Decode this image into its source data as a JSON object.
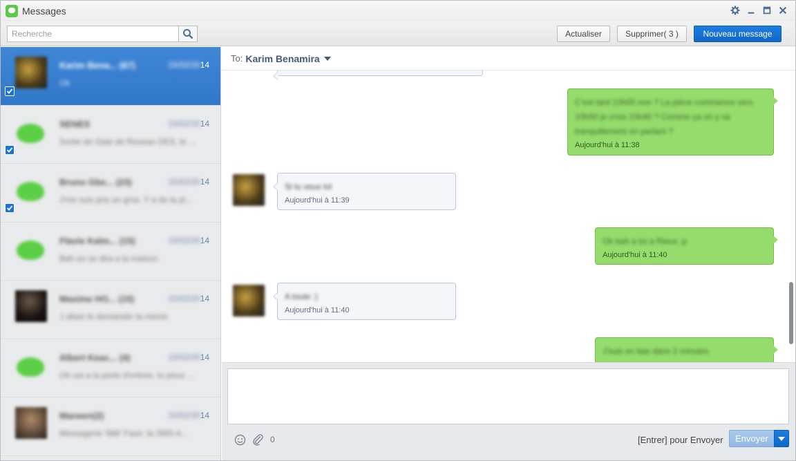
{
  "window": {
    "title": "Messages"
  },
  "toolbar": {
    "search_placeholder": "Recherche",
    "refresh_label": "Actualiser",
    "delete_label": "Supprimer( 3 )",
    "new_message_label": "Nouveau message"
  },
  "conversations": [
    {
      "name": "Karim Bena... (67)",
      "date_blur": "15/02/20",
      "date_tail": "14",
      "snippet": "Ok",
      "avatar": "photo1",
      "checked": true,
      "active": true
    },
    {
      "name": "SENES",
      "date_blur": "15/02/20",
      "date_tail": "14",
      "snippet": "Sortie de Gate de Reveau GES, le ...",
      "avatar": "green",
      "checked": true,
      "active": false
    },
    {
      "name": "Bruno Gbe... (23)",
      "date_blur": "15/02/20",
      "date_tail": "14",
      "snippet": "J'me suis pris un gros. Y a de la pl...",
      "avatar": "green",
      "checked": true,
      "active": false
    },
    {
      "name": "Flavie Kalm... (15)",
      "date_blur": "15/02/20",
      "date_tail": "14",
      "snippet": "Bah on se dira a la maison.",
      "avatar": "green",
      "checked": false,
      "active": false
    },
    {
      "name": "Maxime HO... (15)",
      "date_blur": "15/02/20",
      "date_tail": "14",
      "snippet": "J allais te demander la meme",
      "avatar": "photo2",
      "checked": false,
      "active": false
    },
    {
      "name": "Albert Keac... (4)",
      "date_blur": "15/02/20",
      "date_tail": "14",
      "snippet": "Oh oui a la porte d'entree, tu peux ...",
      "avatar": "green",
      "checked": false,
      "active": false
    },
    {
      "name": "Marwen(2)",
      "date_blur": "15/02/20",
      "date_tail": "14",
      "snippet": "Messagerie '666' Faxe: la SMS d...",
      "avatar": "photo3",
      "checked": false,
      "active": false
    }
  ],
  "chat": {
    "to_label": "To:",
    "recipient": "Karim Benamira",
    "messages": [
      {
        "dir": "out",
        "text": "C'est tard 10h00 non ? La pièce commence vers 10h00 je crois 10h40 ? Comme ça on y va tranquillement en parlant ?",
        "time": "Aujourd'hui à 11:38"
      },
      {
        "dir": "in",
        "text": "Si tu veux lol",
        "time": "Aujourd'hui à 11:39"
      },
      {
        "dir": "out",
        "text": "Ok bah a toi a Rieux :p",
        "time": "Aujourd'hui à 11:40"
      },
      {
        "dir": "in",
        "text": "A toute :)",
        "time": "Aujourd'hui à 11:40"
      },
      {
        "dir": "out",
        "text": "J'suis en bas dans 2 minutes",
        "time": ""
      }
    ]
  },
  "composer": {
    "attach_count": "0",
    "hint": "[Entrer] pour Envoyer",
    "send_label": "Envoyer"
  }
}
